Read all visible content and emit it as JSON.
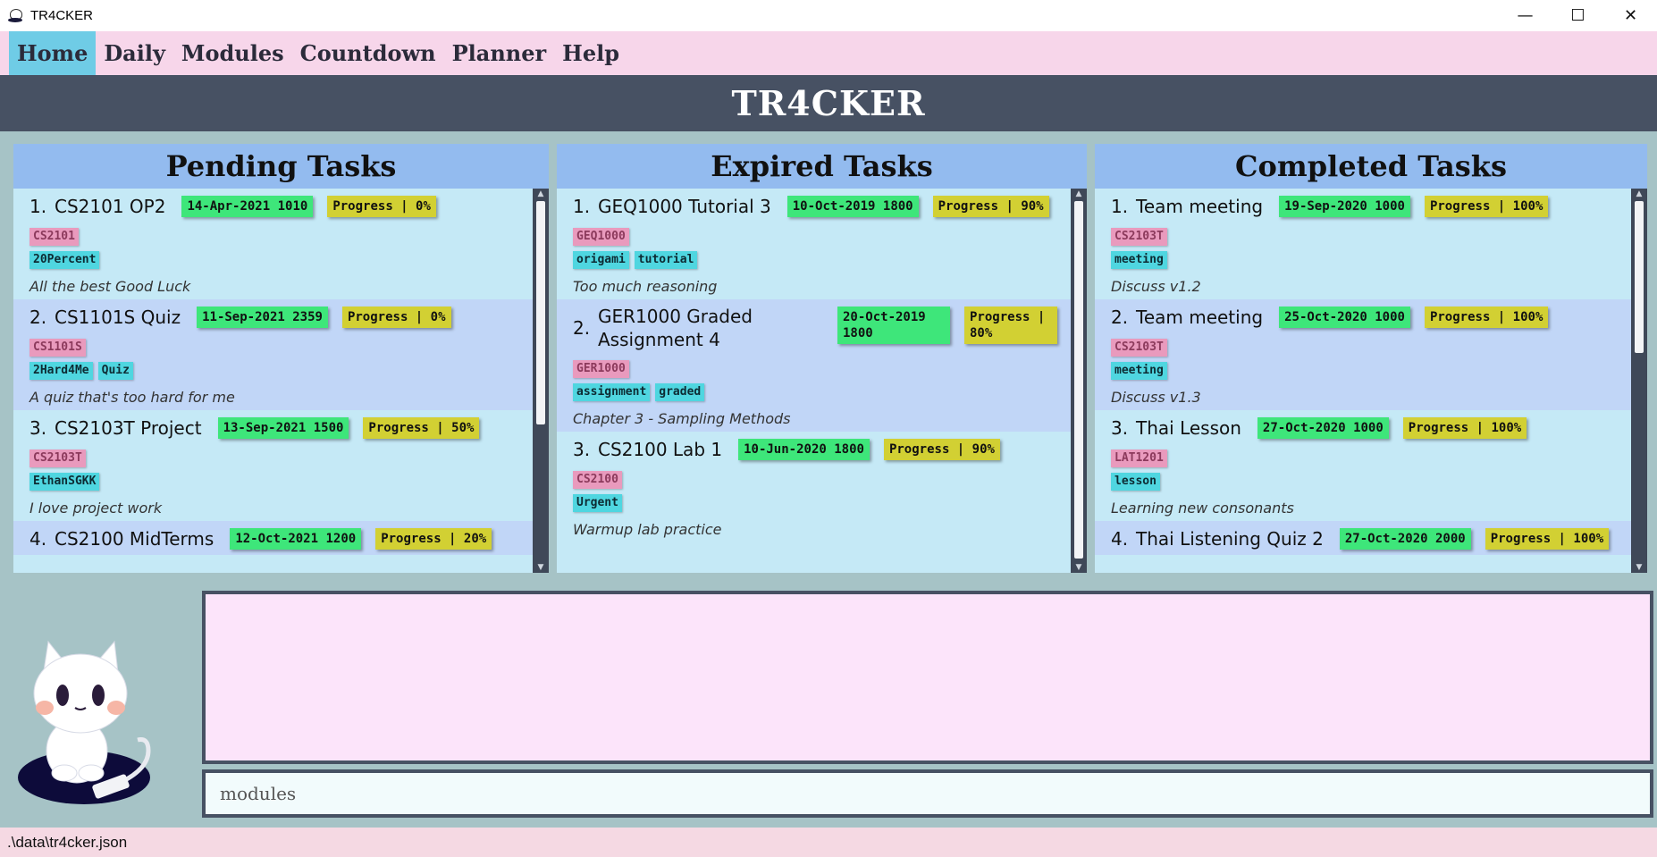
{
  "window": {
    "title": "TR4CKER",
    "controls": [
      "—",
      "☐",
      "✕"
    ]
  },
  "menu": {
    "items": [
      {
        "label": "Home",
        "active": true
      },
      {
        "label": "Daily",
        "active": false
      },
      {
        "label": "Modules",
        "active": false
      },
      {
        "label": "Countdown",
        "active": false
      },
      {
        "label": "Planner",
        "active": false
      },
      {
        "label": "Help",
        "active": false
      }
    ]
  },
  "header": {
    "title": "TR4CKER"
  },
  "panels": {
    "pending": {
      "title": "Pending Tasks",
      "tasks": [
        {
          "num": "1.",
          "name": "CS2101 OP2",
          "deadline": "14-Apr-2021 1010",
          "progress": "Progress | 0%",
          "module": "CS2101",
          "tags": [
            "20Percent"
          ],
          "desc": "All the best Good Luck"
        },
        {
          "num": "2.",
          "name": "CS1101S Quiz",
          "deadline": "11-Sep-2021 2359",
          "progress": "Progress | 0%",
          "module": "CS1101S",
          "tags": [
            "2Hard4Me",
            "Quiz"
          ],
          "desc": "A quiz that's too hard for me"
        },
        {
          "num": "3.",
          "name": "CS2103T Project",
          "deadline": "13-Sep-2021 1500",
          "progress": "Progress | 50%",
          "module": "CS2103T",
          "tags": [
            "EthanSGKK"
          ],
          "desc": "I love project work"
        },
        {
          "num": "4.",
          "name": "CS2100 MidTerms",
          "deadline": "12-Oct-2021 1200",
          "progress": "Progress | 20%",
          "module": "",
          "tags": [],
          "desc": ""
        }
      ]
    },
    "expired": {
      "title": "Expired Tasks",
      "tasks": [
        {
          "num": "1.",
          "name": "GEQ1000 Tutorial 3",
          "deadline": "10-Oct-2019 1800",
          "progress": "Progress | 90%",
          "module": "GEQ1000",
          "tags": [
            "origami",
            "tutorial"
          ],
          "desc": "Too much reasoning"
        },
        {
          "num": "2.",
          "name": "GER1000 Graded Assignment 4",
          "deadline": "20-Oct-2019 1800",
          "progress": "Progress | 80%",
          "module": "GER1000",
          "tags": [
            "assignment",
            "graded"
          ],
          "desc": "Chapter 3 - Sampling Methods"
        },
        {
          "num": "3.",
          "name": "CS2100 Lab 1",
          "deadline": "10-Jun-2020 1800",
          "progress": "Progress | 90%",
          "module": "CS2100",
          "tags": [
            "Urgent"
          ],
          "desc": "Warmup lab practice"
        }
      ]
    },
    "completed": {
      "title": "Completed Tasks",
      "tasks": [
        {
          "num": "1.",
          "name": "Team meeting",
          "deadline": "19-Sep-2020 1000",
          "progress": "Progress | 100%",
          "module": "CS2103T",
          "tags": [
            "meeting"
          ],
          "desc": "Discuss v1.2"
        },
        {
          "num": "2.",
          "name": "Team meeting",
          "deadline": "25-Oct-2020 1000",
          "progress": "Progress | 100%",
          "module": "CS2103T",
          "tags": [
            "meeting"
          ],
          "desc": "Discuss v1.3"
        },
        {
          "num": "3.",
          "name": "Thai Lesson",
          "deadline": "27-Oct-2020 1000",
          "progress": "Progress | 100%",
          "module": "LAT1201",
          "tags": [
            "lesson"
          ],
          "desc": "Learning new consonants"
        },
        {
          "num": "4.",
          "name": "Thai Listening Quiz 2",
          "deadline": "27-Oct-2020 2000",
          "progress": "Progress | 100%",
          "module": "",
          "tags": [],
          "desc": ""
        }
      ]
    }
  },
  "result": {
    "text": ""
  },
  "command": {
    "value": "modules"
  },
  "status": {
    "path": ".\\data\\tr4cker.json"
  },
  "colors": {
    "menu_bg": "#f7d6ea",
    "menu_active": "#6fcce6",
    "header_bg": "#475163",
    "panel_title_bg": "#93bbef",
    "task_bg": "#c5e9f6",
    "task_alt_bg": "#c1d6f7",
    "date_pill": "#3ee67a",
    "progress_pill": "#d2d033",
    "module_tag": "#e99abd",
    "label_tag": "#4fd6e0"
  }
}
